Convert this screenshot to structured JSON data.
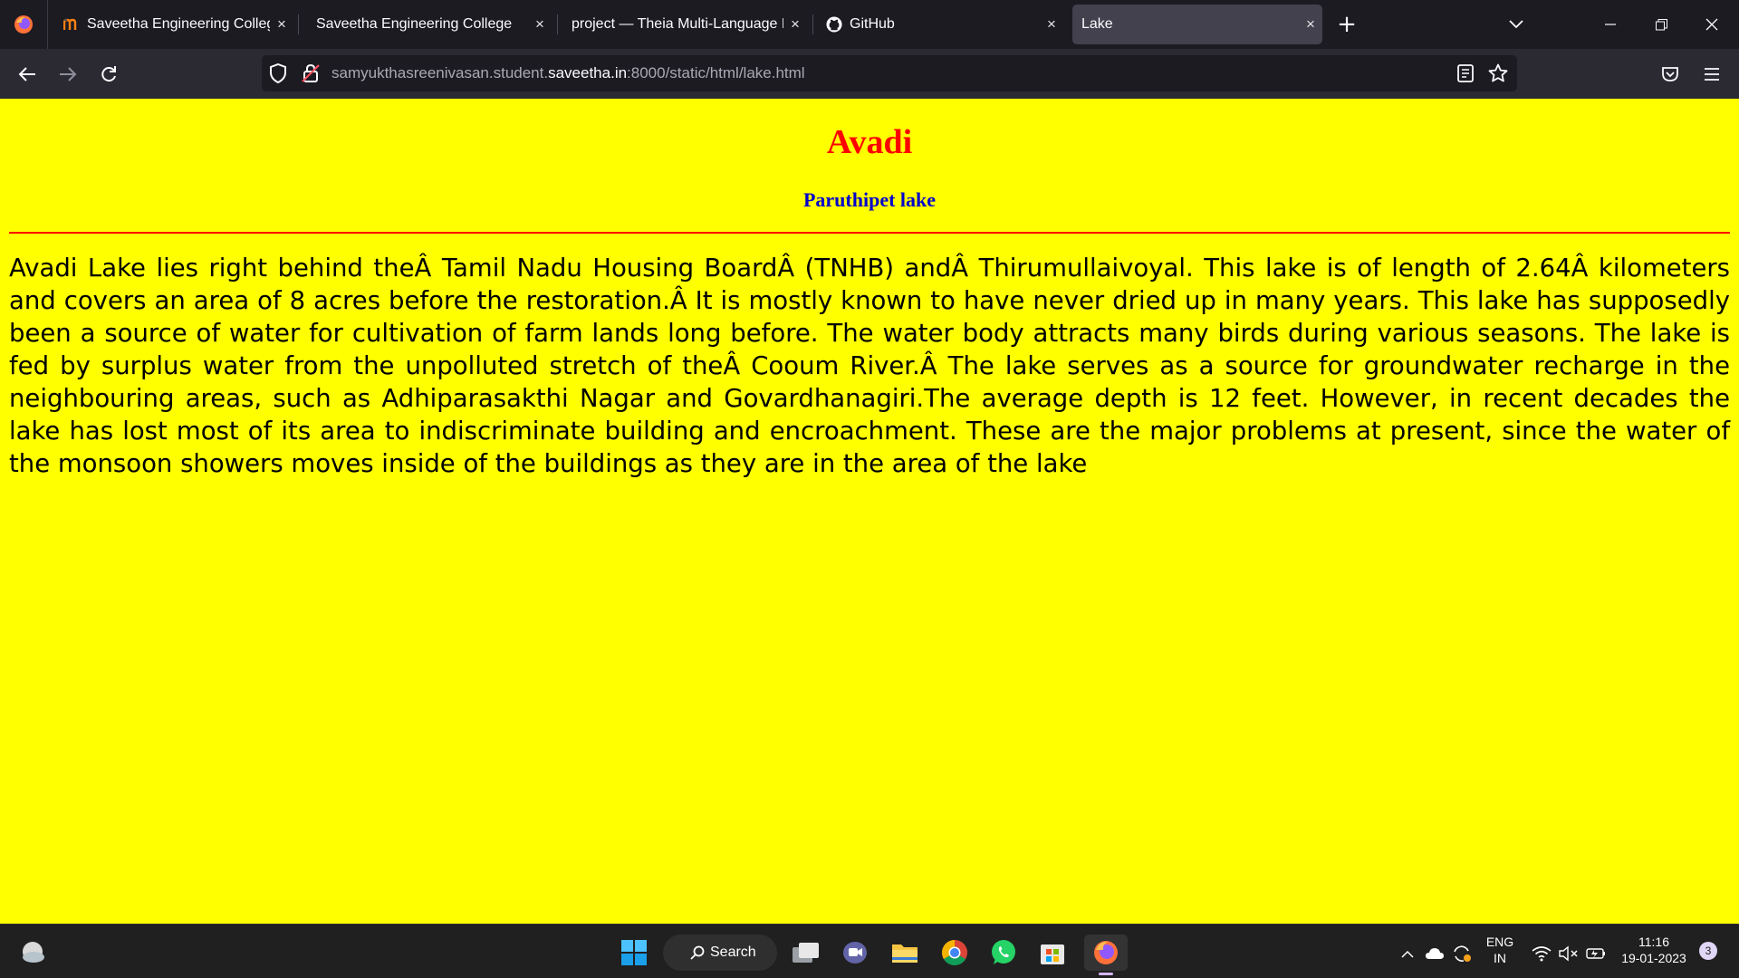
{
  "browser": {
    "tabs": [
      {
        "title": "Saveetha Engineering College",
        "favicon": "moodle-m-icon",
        "active": false
      },
      {
        "title": "Saveetha Engineering College",
        "favicon": "",
        "active": false
      },
      {
        "title": "project — Theia Multi-Language Ex",
        "favicon": "",
        "active": false
      },
      {
        "title": "GitHub",
        "favicon": "github-icon",
        "active": false
      },
      {
        "title": "Lake",
        "favicon": "",
        "active": true
      }
    ],
    "new_tab_symbol": "+",
    "close_symbol": "×",
    "url": {
      "prefix": "samyukthasreenivasan.student.",
      "host": "saveetha.in",
      "suffix": ":8000/static/html/lake.html"
    }
  },
  "page": {
    "heading": "Avadi",
    "subheading": "Paruthipet lake",
    "paragraph": "Avadi Lake lies right behind theÂ Tamil Nadu Housing BoardÂ (TNHB) andÂ Thirumullaivoyal. This lake is of length of 2.64Â kilometers and covers an area of 8 acres before the restoration.Â It is mostly known to have never dried up in many years. This lake has supposedly been a source of water for cultivation of farm lands long before. The water body attracts many birds during various seasons. The lake is fed by surplus water from the unpolluted stretch of theÂ Cooum River.Â The lake serves as a source for groundwater recharge in the neighbouring areas, such as Adhiparasakthi Nagar and Govardhanagiri.The average depth is 12 feet. However, in recent decades the lake has lost most of its area to indiscriminate building and encroachment. These are the major problems at present, since the water of the monsoon showers moves inside of the buildings as they are in the area of the lake",
    "colors": {
      "background": "#ffff00",
      "heading": "#ff0000",
      "subheading": "#0000cc",
      "rule": "#ff0000"
    }
  },
  "taskbar": {
    "search_label": "Search",
    "language": "ENG",
    "region": "IN",
    "time": "11:16",
    "date": "19-01-2023",
    "notification_count": "3"
  }
}
